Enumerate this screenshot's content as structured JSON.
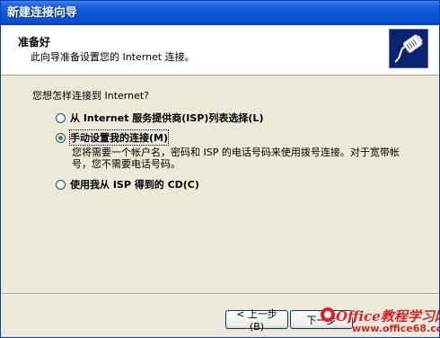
{
  "window": {
    "title": "新建连接向导"
  },
  "header": {
    "title": "准备好",
    "subtitle": "此向导准备设置您的 Internet 连接。",
    "icon": "network-cable-icon"
  },
  "body": {
    "question": "您想怎样连接到 Internet?",
    "options": [
      {
        "label": "从 Internet 服务提供商(ISP)列表选择(L)",
        "checked": false
      },
      {
        "label": "手动设置我的连接(M)",
        "checked": true,
        "description": "您将需要一个帐户名，密码和 ISP 的电话号码来使用拨号连接。对于宽带帐号，您不需要电话号码。"
      },
      {
        "label": "使用我从 ISP 得到的 CD(C)",
        "checked": false
      }
    ]
  },
  "footer": {
    "back_label": "< 上一步(B)",
    "next_label": "下一步"
  },
  "watermark": {
    "line1": "Office教程学习网",
    "line2": "www.office68.com"
  },
  "colors": {
    "titlebar": "#0856d8",
    "dialog_bg": "#ece9d8",
    "radio_dot": "#2a9c20",
    "watermark": "#e31d1d"
  }
}
